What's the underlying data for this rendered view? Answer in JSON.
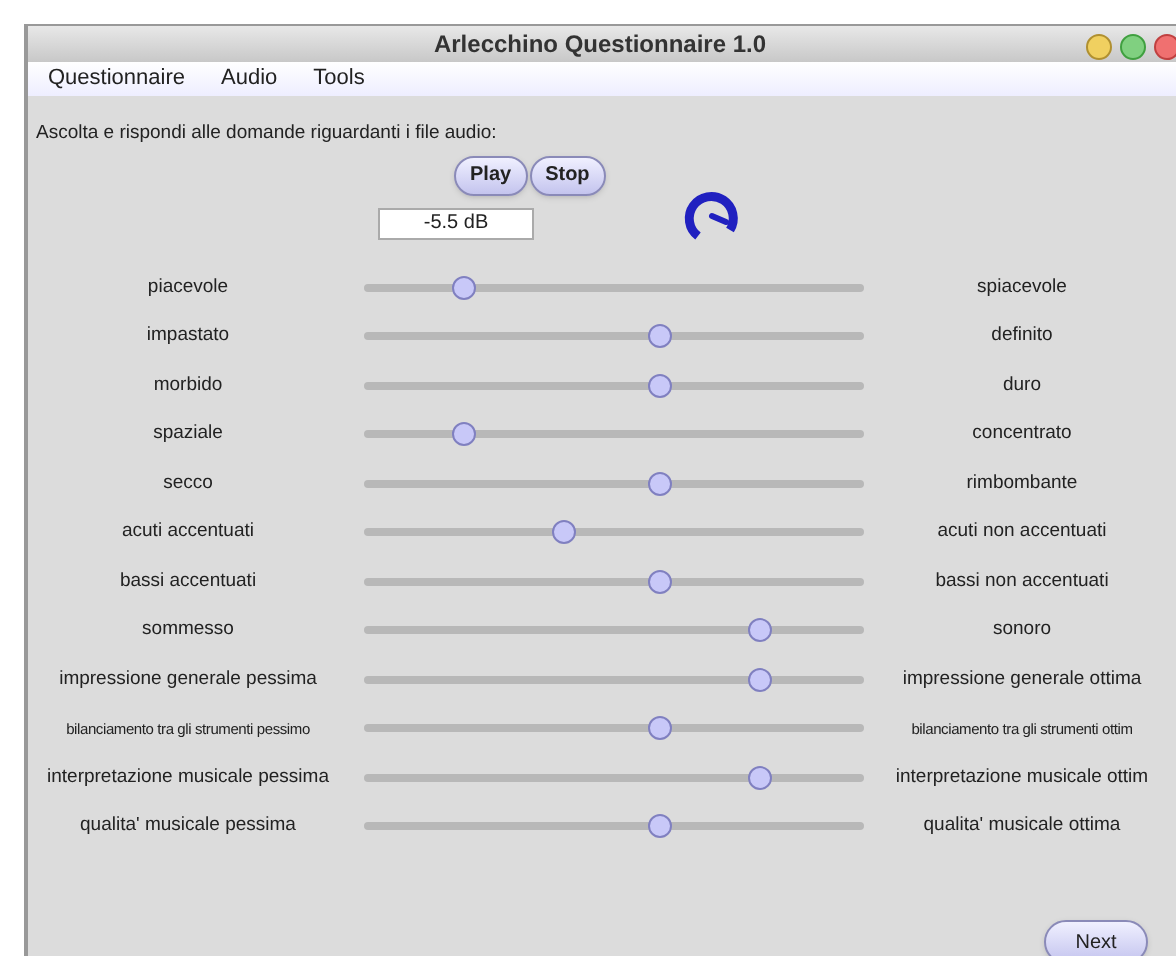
{
  "window": {
    "title": "Arlecchino Questionnaire 1.0"
  },
  "menu": [
    "Questionnaire",
    "Audio",
    "Tools"
  ],
  "instruction": "Ascolta e rispondi alle domande riguardanti i file audio:",
  "buttons": [
    "Play",
    "Stop"
  ],
  "volume": {
    "value": "-5.5 dB"
  },
  "scales": [
    {
      "left": "piacevole",
      "right": "spiacevole",
      "level": 0.2
    },
    {
      "left": "impastato",
      "right": "definito",
      "level": 0.59
    },
    {
      "left": "morbido",
      "right": "duro",
      "level": 0.59
    },
    {
      "left": "spaziale",
      "right": "concentrato",
      "level": 0.2
    },
    {
      "left": "secco",
      "right": "rimbombante",
      "level": 0.59
    },
    {
      "left": "acuti accentuati",
      "right": "acuti non accentuati",
      "level": 0.4
    },
    {
      "left": "bassi accentuati",
      "right": "bassi non accentuati",
      "level": 0.59
    },
    {
      "left": "sommesso",
      "right": "sonoro",
      "level": 0.79
    },
    {
      "left": "impressione generale pessima",
      "right": "impressione generale ottima",
      "level": 0.79
    },
    {
      "left": "bilanciamento tra gli strumenti pessimo",
      "right": "bilanciamento tra gli strumenti ottim",
      "level": 0.59,
      "kind": "small"
    },
    {
      "left": "interpretazione musicale pessima",
      "right": "interpretazione musicale ottim",
      "level": 0.79
    },
    {
      "left": "qualita' musicale pessima",
      "right": "qualita' musicale ottima",
      "level": 0.59
    }
  ],
  "next_button": "Next"
}
